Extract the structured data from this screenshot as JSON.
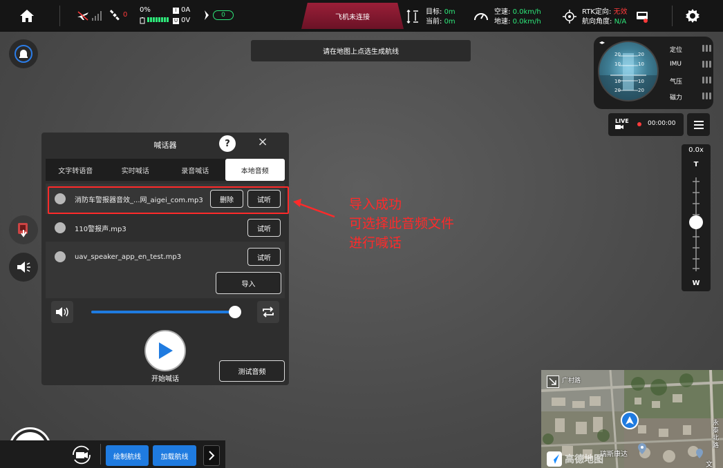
{
  "topbar": {
    "signal_count": "0",
    "battery_percent": "0%",
    "current": "0A",
    "voltage": "0V",
    "gps_count": "0",
    "connection_status": "飞机未连接",
    "target_label": "目标:",
    "target_value": "0m",
    "current_label": "当前:",
    "current_value": "0m",
    "airspeed_label": "空速:",
    "airspeed_value": "0.0km/h",
    "groundspeed_label": "地速:",
    "groundspeed_value": "0.0km/h",
    "rtk_label": "RTK定向:",
    "rtk_value": "无效",
    "heading_label": "航向角度:",
    "heading_value": "N/A"
  },
  "hint": "请在地图上点选生成航线",
  "attitude": {
    "scale": [
      "20",
      "10",
      "10",
      "20"
    ],
    "labels": [
      "定位",
      "IMU",
      "气压",
      "磁力"
    ]
  },
  "live": {
    "label": "LIVE",
    "time": "00:00:00"
  },
  "zoom": {
    "value": "0.0x",
    "tele": "T",
    "wide": "W",
    "level": 0.48
  },
  "panel": {
    "title": "喊话器",
    "help": "?",
    "close": "×",
    "tabs": [
      "文字转语音",
      "实时喊话",
      "录音喊话",
      "本地音频"
    ],
    "active_tab": 3,
    "files": [
      {
        "name": "消防车警报器音效_...网_aigei_com.mp3",
        "delete": "删除",
        "preview": "试听"
      },
      {
        "name": "110警报声.mp3",
        "preview": "试听"
      },
      {
        "name": "uav_speaker_app_en_test.mp3",
        "preview": "试听"
      }
    ],
    "import": "导入",
    "volume": 0.97,
    "start_label": "开始喊话",
    "test_label": "测试音频"
  },
  "annotation": {
    "lines": [
      "导入成功",
      "可选择此音频文件",
      "进行喊话"
    ],
    "color": "#ff2a2a"
  },
  "bottom": {
    "draw_route": "绘制航线",
    "load_route": "加载航线"
  },
  "map": {
    "label1": "瑞斯康达",
    "label2": "文",
    "label3": "高德地图",
    "label4": "广村路",
    "label5": "永泰北路"
  }
}
